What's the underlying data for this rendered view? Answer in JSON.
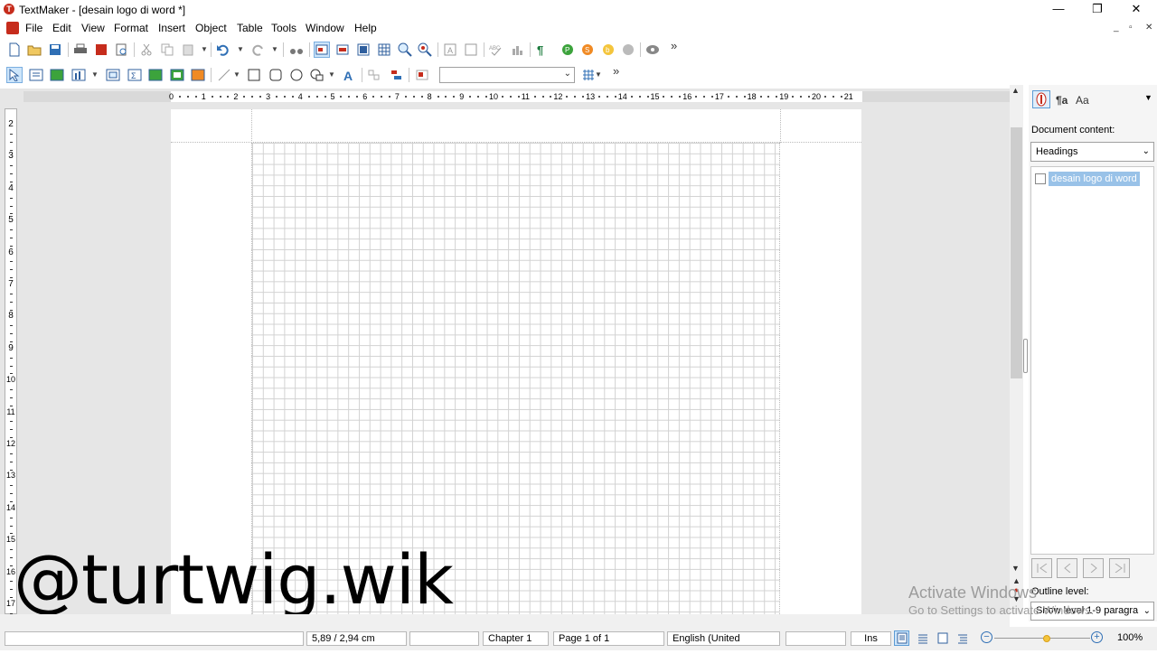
{
  "window": {
    "title": "TextMaker - [desain logo di word *]",
    "controls": {
      "minimize": "—",
      "restore": "❐",
      "close": "✕"
    }
  },
  "menu": {
    "items": [
      "File",
      "Edit",
      "View",
      "Format",
      "Insert",
      "Object",
      "Table",
      "Tools",
      "Window",
      "Help"
    ],
    "mdi_controls": [
      "_",
      "▫",
      "✕"
    ]
  },
  "toolbar": {
    "overflow_glyph": "»",
    "style_combo_value": ""
  },
  "ruler": {
    "labels": [
      "0",
      "1",
      "2",
      "3",
      "4",
      "5",
      "6",
      "7",
      "8",
      "9",
      "10",
      "11",
      "12",
      "13",
      "14",
      "15",
      "16",
      "17",
      "18",
      "19",
      "20",
      "21"
    ],
    "vertical_labels": [
      "2",
      "3",
      "4",
      "5",
      "6",
      "7",
      "8",
      "9",
      "10",
      "11",
      "12",
      "13",
      "14",
      "15",
      "16",
      "17"
    ]
  },
  "document": {
    "watermark_text": "@turtwig.wik"
  },
  "sidepanel": {
    "content_label": "Document content:",
    "content_select": "Headings",
    "tree_items": [
      "desain logo di word"
    ],
    "outline_label": "Outline level:",
    "outline_select": "Show level 1-9 paragra"
  },
  "os_overlay": {
    "line1": "Activate Windows",
    "line2": "Go to Settings to activate Windows."
  },
  "statusbar": {
    "field1": "",
    "position": "5,89 / 2,94 cm",
    "field3": "",
    "chapter": "Chapter 1",
    "page": "Page 1 of 1",
    "language": "English (United",
    "field7": "",
    "mode": "Ins",
    "zoom": "100%",
    "zoom_level_fraction": 0.55
  },
  "colors": {
    "accent": "#c62c1c",
    "selection": "#99c2e8",
    "workspace": "#e6e6e6"
  }
}
